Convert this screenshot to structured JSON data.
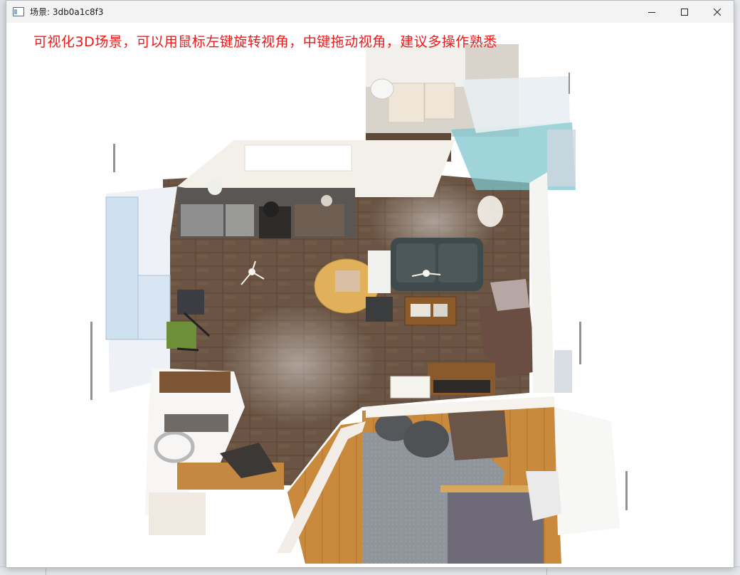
{
  "window": {
    "title": "场景: 3db0a1c8f3",
    "controls": {
      "minimize_icon": "minimize-icon",
      "maximize_icon": "maximize-icon",
      "close_icon": "close-icon"
    }
  },
  "viewport": {
    "instruction_text": "可视化3D场景，可以用鼠标左键旋转视角，中键拖动视角，建议多操作熟悉",
    "instruction_color": "#f01818"
  },
  "colors": {
    "floor": "#6b5443",
    "wood_floor": "#c98a3e",
    "carpet": "#8f959b",
    "sofa": "#3f4a4d",
    "table": "#e0b15a"
  }
}
